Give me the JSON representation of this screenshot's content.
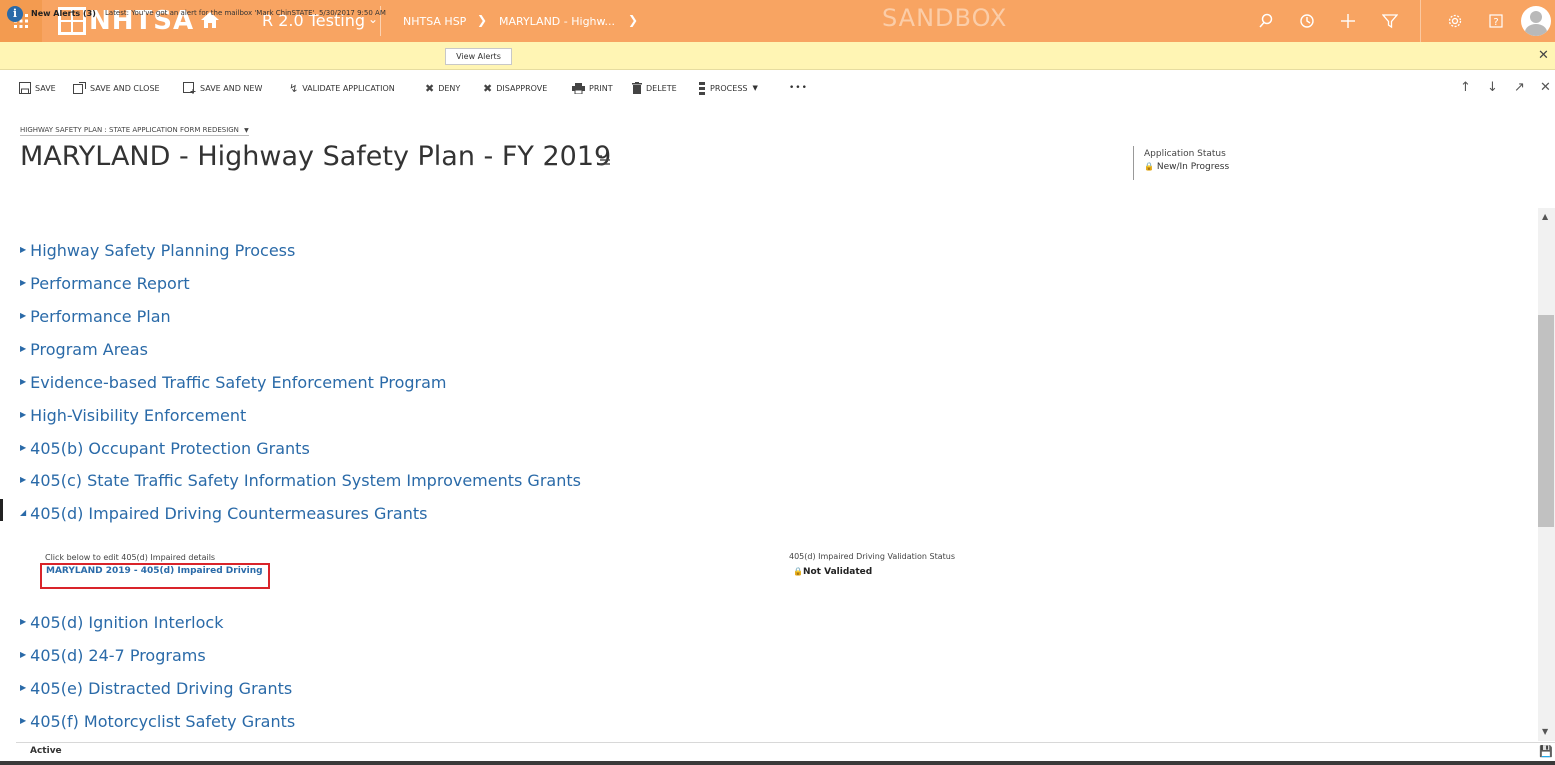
{
  "topnav": {
    "logo_text": "NHTSA",
    "app_name": "R 2.0 Testing",
    "breadcrumb_area": "NHTSA HSP",
    "breadcrumb_record": "MARYLAND - Highw...",
    "watermark": "SANDBOX"
  },
  "alert": {
    "title": "New Alerts (3)",
    "text": "Latest: You've got an alert for the mailbox 'Mark ChinSTATE'. 5/30/2017 9:50 AM",
    "button_label": "View Alerts"
  },
  "commands": {
    "save": "SAVE",
    "save_and_close": "SAVE AND CLOSE",
    "save_and_new": "SAVE AND NEW",
    "validate_application": "VALIDATE APPLICATION",
    "deny": "DENY",
    "disapprove": "DISAPPROVE",
    "print": "PRINT",
    "delete": "DELETE",
    "process": "PROCESS",
    "more": "•••"
  },
  "header": {
    "form_selector": "HIGHWAY SAFETY PLAN : STATE APPLICATION FORM REDESIGN",
    "title": "MARYLAND - Highway Safety Plan - FY 2019",
    "status_label": "Application Status",
    "status_value": "New/In Progress"
  },
  "sections": [
    {
      "label": "Highway Safety Planning Process",
      "expanded": false
    },
    {
      "label": "Performance Report",
      "expanded": false
    },
    {
      "label": "Performance Plan",
      "expanded": false
    },
    {
      "label": "Program Areas",
      "expanded": false
    },
    {
      "label": "Evidence-based Traffic Safety Enforcement Program",
      "expanded": false
    },
    {
      "label": "High-Visibility Enforcement",
      "expanded": false
    },
    {
      "label": "405(b) Occupant Protection Grants",
      "expanded": false
    },
    {
      "label": "405(c) State Traffic Safety Information System Improvements Grants",
      "expanded": false
    },
    {
      "label": "405(d) Impaired Driving Countermeasures Grants",
      "expanded": true
    },
    {
      "label": "405(d) Ignition Interlock",
      "expanded": false
    },
    {
      "label": "405(d) 24-7 Programs",
      "expanded": false
    },
    {
      "label": "405(e) Distracted Driving Grants",
      "expanded": false
    },
    {
      "label": "405(f) Motorcyclist Safety Grants",
      "expanded": false
    }
  ],
  "impaired_section": {
    "edit_label": "Click below to edit 405(d) Impaired details",
    "edit_link": "MARYLAND 2019 - 405(d) Impaired Driving",
    "validation_label": "405(d) Impaired Driving Validation Status",
    "validation_value": "Not Validated"
  },
  "footer": {
    "status": "Active"
  },
  "colors": {
    "nav_bg": "#f8a462",
    "alert_bg": "#fff5b4",
    "link": "#2a6aa8",
    "highlight_box": "#d9242a"
  }
}
